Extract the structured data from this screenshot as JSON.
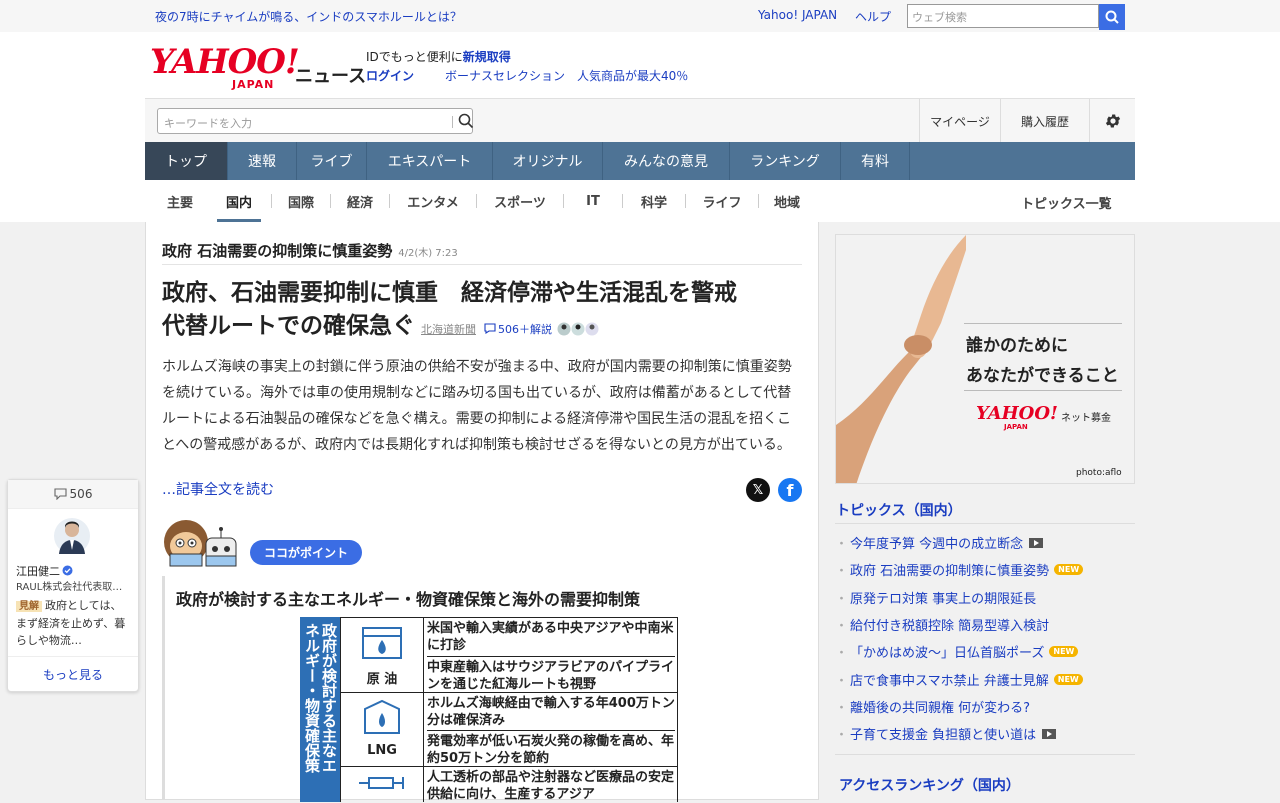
{
  "topbar": {
    "promo": "夜の7時にチャイムが鳴る、インドのスマホルールとは？",
    "yahoo_link": "Yahoo! JAPAN",
    "help": "ヘルプ",
    "web_search_placeholder": "ウェブ検索"
  },
  "header": {
    "logo_main": "YAHOO!",
    "logo_sub": "JAPAN",
    "logo_news": "ニュース",
    "id_text": "IDでもっと便利に",
    "register": "新規取得",
    "login": "ログイン",
    "bonus": "ボーナスセレクション　人気商品が最大40％"
  },
  "search": {
    "placeholder": "キーワードを入力",
    "mypage": "マイページ",
    "history": "購入履歴"
  },
  "nav": [
    {
      "label": "トップ"
    },
    {
      "label": "速報"
    },
    {
      "label": "ライブ"
    },
    {
      "label": "エキスパート"
    },
    {
      "label": "オリジナル"
    },
    {
      "label": "みんなの意見"
    },
    {
      "label": "ランキング"
    },
    {
      "label": "有料"
    }
  ],
  "subnav": [
    {
      "label": "主要"
    },
    {
      "label": "国内"
    },
    {
      "label": "国際"
    },
    {
      "label": "経済"
    },
    {
      "label": "エンタメ"
    },
    {
      "label": "スポーツ"
    },
    {
      "label": "IT"
    },
    {
      "label": "科学"
    },
    {
      "label": "ライフ"
    },
    {
      "label": "地域"
    }
  ],
  "topics_all": "トピックス一覧",
  "article": {
    "headline": "政府 石油需要の抑制策に慎重姿勢",
    "date": "4/2(木) 7:23",
    "title_line1": "政府、石油需要抑制に慎重　経済停滞や生活混乱を警戒",
    "title_line2": "代替ルートでの確保急ぐ",
    "source": "北海道新聞",
    "comments": "506＋解説",
    "body": "ホルムズ海峡の事実上の封鎖に伴う原油の供給不安が強まる中、政府が国内需要の抑制策に慎重姿勢を続けている。海外では車の使用規制などに踏み切る国も出ているが、政府は備蓄があるとして代替ルートによる石油製品の確保などを急ぐ構え。需要の抑制による経済停滞や国民生活の混乱を招くことへの警戒感があるが、政府内では長期化すれば抑制策も検討せざるを得ないとの見方が出ている。",
    "read_more": "…記事全文を読む",
    "point_label": "ココがポイント",
    "figure_title": "政府が検討する主なエネルギー・物資確保策と海外の需要抑制策"
  },
  "figure": {
    "side_text": "政府が検討する主なエネルギー・物資確保策",
    "rows": [
      {
        "label": "原 油",
        "items": [
          "米国や輸入実績がある中央アジアや中南米に打診",
          "中東産輸入はサウジアラビアのパイプラインを通じた紅海ルートも視野"
        ]
      },
      {
        "label": "LNG",
        "items": [
          "ホルムズ海峡経由で輸入する年400万トン分は確保済み",
          "発電効率が低い石炭火発の稼働を高め、年約50万トン分を節約"
        ]
      },
      {
        "label": "",
        "items": [
          "人工透析の部品や注射器など医療品の安定供給に向け、生産するアジア"
        ]
      }
    ]
  },
  "ad": {
    "line1": "誰かのために",
    "line2": "あなたができること",
    "logo": "YAHOO!",
    "logo_sub": "JAPAN",
    "logo_tail": "ネット募金",
    "credit": "photo:aflo"
  },
  "topics": {
    "heading": "トピックス（国内）",
    "items": [
      {
        "label": "今年度予算 今週中の成立断念",
        "badge": "video"
      },
      {
        "label": "政府 石油需要の抑制策に慎重姿勢",
        "badge": "NEW"
      },
      {
        "label": "原発テロ対策 事実上の期限延長",
        "badge": ""
      },
      {
        "label": "給付付き税額控除 簡易型導入検討",
        "badge": ""
      },
      {
        "label": "「かめはめ波～」日仏首脳ポーズ",
        "badge": "NEW"
      },
      {
        "label": "店で食事中スマホ禁止 弁護士見解",
        "badge": "NEW"
      },
      {
        "label": "離婚後の共同親権 何が変わる?",
        "badge": ""
      },
      {
        "label": "子育て支援金 負担額と使い道は",
        "badge": "video"
      }
    ]
  },
  "ranking_heading": "アクセスランキング（国内）",
  "comment_card": {
    "count": "506",
    "name": "江田健二",
    "role": "RAUL株式会社代表取締役",
    "badge": "見解",
    "text": "政府としては、まず経済を止めず、暮らしや物流…",
    "more": "もっと見る"
  }
}
